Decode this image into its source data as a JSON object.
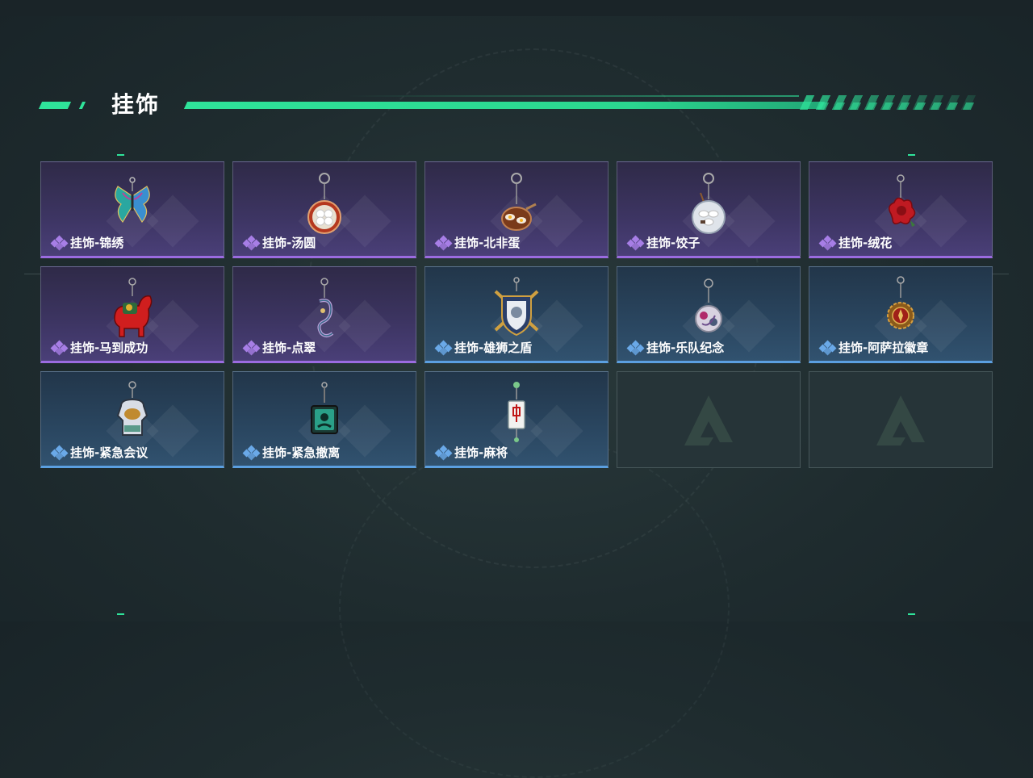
{
  "section": {
    "title": "挂饰"
  },
  "colors": {
    "accent": "#2fe39a",
    "purple_rarity": "#9b6be0",
    "blue_rarity": "#5b9fe0"
  },
  "items": [
    {
      "name": "挂饰-锦绣",
      "rarity": "purple",
      "icon": "butterfly-charm-icon"
    },
    {
      "name": "挂饰-汤圆",
      "rarity": "purple",
      "icon": "tangyuan-bowl-charm-icon"
    },
    {
      "name": "挂饰-北非蛋",
      "rarity": "purple",
      "icon": "shakshuka-charm-icon"
    },
    {
      "name": "挂饰-饺子",
      "rarity": "purple",
      "icon": "dumpling-plate-charm-icon"
    },
    {
      "name": "挂饰-绒花",
      "rarity": "purple",
      "icon": "velvet-flower-charm-icon"
    },
    {
      "name": "挂饰-马到成功",
      "rarity": "purple",
      "icon": "red-horse-charm-icon"
    },
    {
      "name": "挂饰-点翠",
      "rarity": "purple",
      "icon": "kingfisher-ornament-charm-icon"
    },
    {
      "name": "挂饰-雄狮之盾",
      "rarity": "blue",
      "icon": "lion-shield-charm-icon"
    },
    {
      "name": "挂饰-乐队纪念",
      "rarity": "blue",
      "icon": "band-badge-charm-icon"
    },
    {
      "name": "挂饰-阿萨拉徽章",
      "rarity": "blue",
      "icon": "asala-medal-charm-icon"
    },
    {
      "name": "挂饰-紧急会议",
      "rarity": "blue",
      "icon": "emergency-meeting-charm-icon"
    },
    {
      "name": "挂饰-紧急撤离",
      "rarity": "blue",
      "icon": "emergency-evac-charm-icon"
    },
    {
      "name": "挂饰-麻将",
      "rarity": "blue",
      "icon": "mahjong-tile-charm-icon"
    }
  ],
  "empty_slots": [
    {
      "icon": "game-logo-icon"
    },
    {
      "icon": "game-logo-icon"
    }
  ]
}
